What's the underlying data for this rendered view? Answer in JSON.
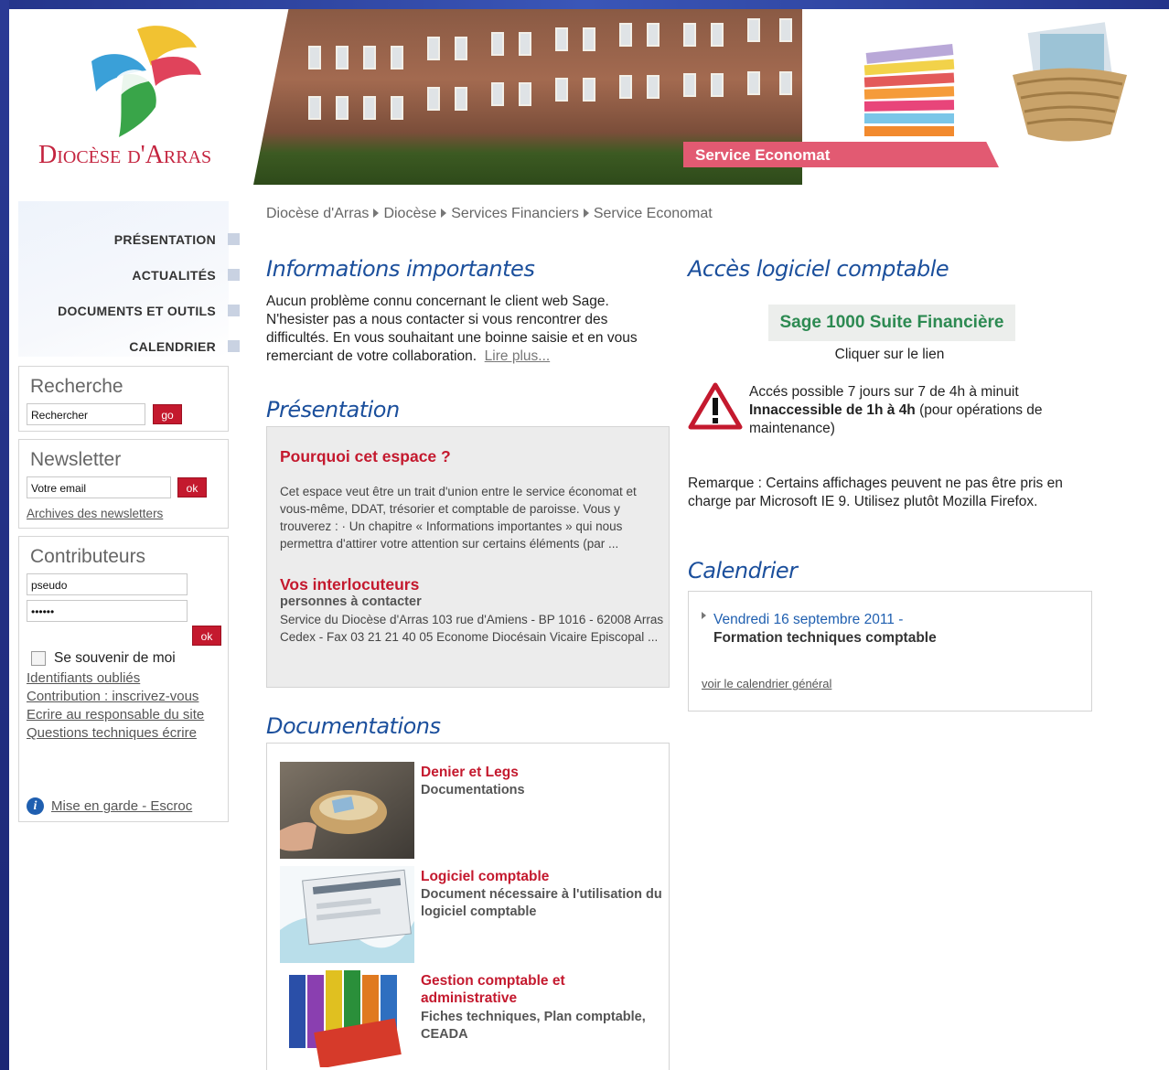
{
  "site": {
    "logo_text": "Diocèse d'Arras",
    "banner_title": "Service Economat"
  },
  "breadcrumb": [
    "Diocèse d'Arras",
    "Diocèse",
    "Services Financiers",
    "Service Economat"
  ],
  "nav": {
    "items": [
      {
        "label": "PRÉSENTATION"
      },
      {
        "label": "ACTUALITÉS"
      },
      {
        "label": "DOCUMENTS ET OUTILS"
      },
      {
        "label": "CALENDRIER"
      }
    ]
  },
  "search": {
    "title": "Recherche",
    "value": "Rechercher",
    "button": "go"
  },
  "newsletter": {
    "title": "Newsletter",
    "value": "Votre email",
    "button": "ok",
    "archives": "Archives des newsletters"
  },
  "contrib": {
    "title": "Contributeurs",
    "pseudo": "pseudo",
    "password": "••••••",
    "button": "ok",
    "remember": "Se souvenir de moi",
    "links": [
      "Identifiants oubliés",
      "Contribution : inscrivez-vous",
      "Ecrire au responsable du site",
      "Questions techniques écrire"
    ],
    "warning_link": "Mise en garde - Escroc"
  },
  "info": {
    "title": "Informations importantes",
    "text": "Aucun problème connu concernant le client web Sage. N'hesister pas a nous contacter si vous rencontrer des difficultés. En vous souhaitant une boinne saisie et en vous remerciant de votre collaboration.",
    "more": "Lire plus..."
  },
  "presentation": {
    "title": "Présentation",
    "why_title": "Pourquoi cet espace ?",
    "why_text": "Cet espace veut être un trait d'union entre le service économat et vous-même, DDAT, trésorier et comptable de paroisse. Vous y trouverez : ·         Un chapitre « Informations importantes » qui nous permettra d'attirer votre attention sur certains éléments (par ...",
    "contacts_title": "Vos interlocuteurs",
    "contacts_sub": "personnes à contacter",
    "contacts_text": "Service du Diocèse d'Arras  103 rue d'Amiens - BP 1016 - 62008 Arras Cedex - Fax 03 21 21 40 05      Econome Diocésain   Vicaire Episcopal ..."
  },
  "docs": {
    "title": "Documentations",
    "items": [
      {
        "title": "Denier et Legs",
        "desc": "Documentations"
      },
      {
        "title": "Logiciel comptable",
        "desc": "Document nécessaire à l'utilisation du logiciel comptable"
      },
      {
        "title": "Gestion comptable et administrative",
        "desc": "Fiches techniques, Plan comptable, CEADA"
      }
    ]
  },
  "access": {
    "title": "Accès logiciel comptable",
    "sage_label": "Sage 1000 Suite Financière",
    "click": "Cliquer sur le lien",
    "line1": "Accés possible 7 jours sur 7 de 4h à minuit",
    "line2_bold": "Innaccessible de 1h à 4h",
    "line2_rest": " (pour opérations de maintenance)",
    "remark": "Remarque : Certains affichages peuvent ne pas être pris en charge par Microsoft IE 9. Utilisez plutôt Mozilla Firefox."
  },
  "calendar": {
    "title": "Calendrier",
    "event_date": "Vendredi 16 septembre 2011 -",
    "event_title": "Formation techniques comptable",
    "all_link": "voir le calendrier général"
  },
  "colors": {
    "accent_red": "#c4192e",
    "heading_blue": "#1b4f9c",
    "sage_green": "#2d8a52",
    "frame_blue": "#24348a"
  }
}
